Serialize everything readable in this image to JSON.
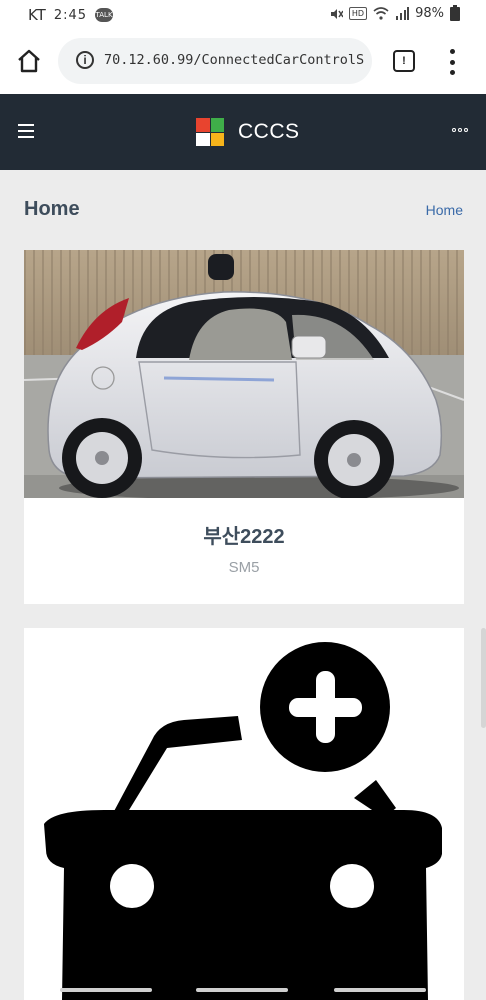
{
  "status_bar": {
    "carrier": "KT",
    "time": "2:45",
    "talk_badge": "TALK",
    "hd_badge": "HD",
    "battery": "98%",
    "icons": [
      "mute-icon",
      "wifi-icon",
      "signal-icon",
      "battery-icon"
    ]
  },
  "browser": {
    "url": "70.12.60.99/ConnectedCarControlS",
    "tab_count": "!",
    "icons": [
      "home-icon",
      "info-icon",
      "tabs-icon",
      "more-vertical-icon"
    ]
  },
  "navbar": {
    "brand": "CCCS",
    "logo_colors": [
      "#e8442f",
      "#3fae49",
      "#2b9fe3",
      "#f6b41b"
    ],
    "background": "#222b35"
  },
  "page": {
    "title": "Home",
    "breadcrumb": "Home"
  },
  "cars": [
    {
      "plate": "부산2222",
      "model": "SM5"
    }
  ],
  "add_car": {
    "icon": "add-car-icon"
  }
}
